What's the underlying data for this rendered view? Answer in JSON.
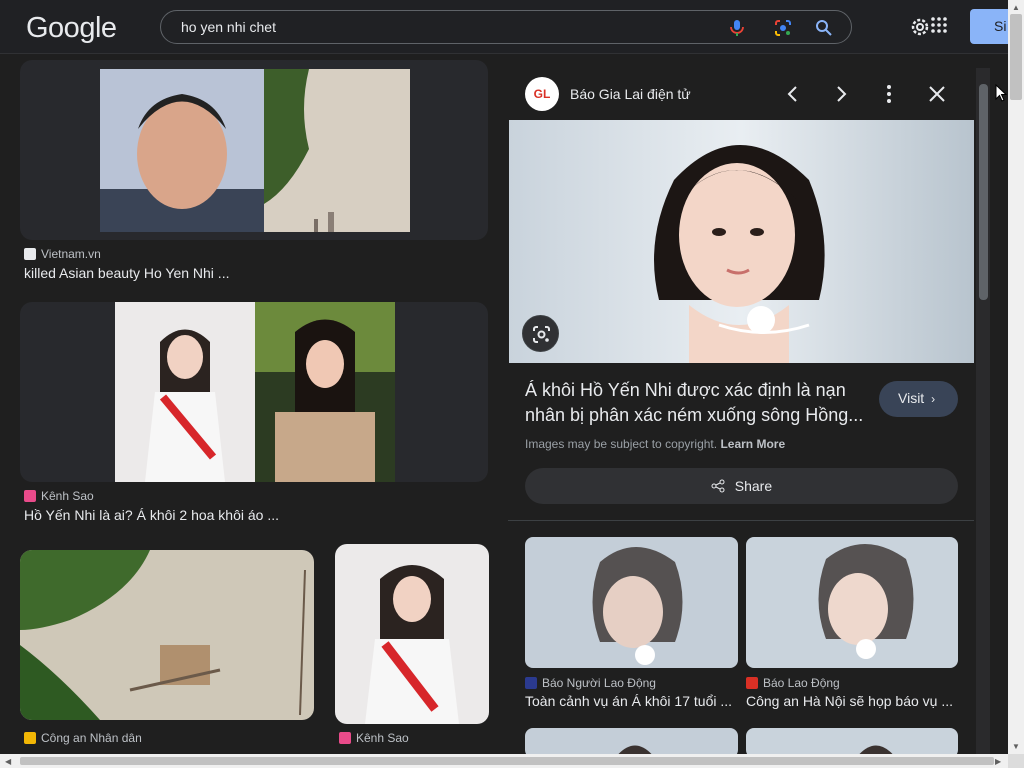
{
  "header": {
    "logo": "Google",
    "search_query": "ho yen nhi chet",
    "signin_label": "Si",
    "icons": [
      "mic-icon",
      "lens-icon",
      "search-icon",
      "gear-icon",
      "apps-icon"
    ]
  },
  "results": [
    {
      "source": "Vietnam.vn",
      "title": "killed Asian beauty Ho Yen Nhi ...",
      "favicon_color": "#e8eaed"
    },
    {
      "source": "Kênh Sao",
      "title": "Hồ Yến Nhi là ai? Á khôi 2 hoa khôi áo ...",
      "favicon_color": "#e94b8a"
    },
    {
      "source": "Công an Nhân dân",
      "title": "",
      "favicon_color": "#f2b705"
    },
    {
      "source": "Kênh Sao",
      "title": "",
      "favicon_color": "#e94b8a"
    }
  ],
  "panel": {
    "site_logo": "GL",
    "site_name": "Báo Gia Lai điện tử",
    "title": "Á khôi Hồ Yến Nhi được xác định là nạn nhân bị phân xác ném xuống sông Hồng...",
    "visit_label": "Visit",
    "copyright_text": "Images may be subject to copyright.",
    "learn_more": "Learn More",
    "share_label": "Share",
    "related": [
      {
        "source": "Báo Người Lao Động",
        "title": "Toàn cảnh vụ án Á khôi 17 tuổi ...",
        "favicon_color": "#2b3a8f"
      },
      {
        "source": "Báo Lao Động",
        "title": "Công an Hà Nội sẽ họp báo vụ ...",
        "favicon_color": "#d93025"
      }
    ]
  },
  "colors": {
    "background": "#1f1f1f",
    "accent": "#8ab4f8",
    "visit_button": "#394457"
  }
}
